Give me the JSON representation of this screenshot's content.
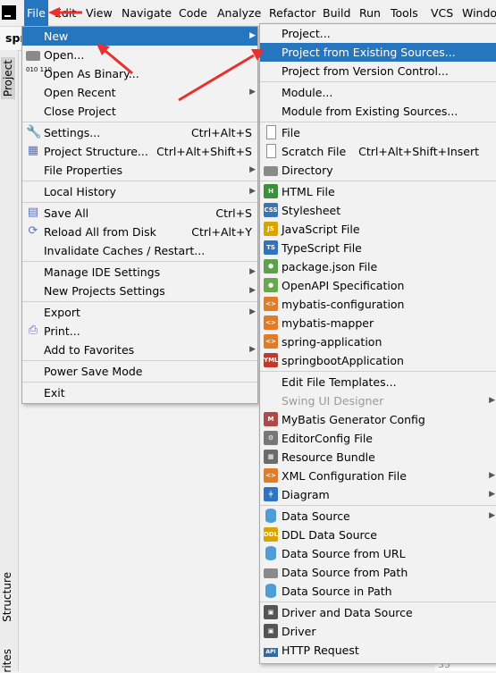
{
  "menubar": [
    "File",
    "Edit",
    "View",
    "Navigate",
    "Code",
    "Analyze",
    "Refactor",
    "Build",
    "Run",
    "Tools",
    "VCS",
    "Windo"
  ],
  "project_crumb": "spr",
  "side_tabs": {
    "project": "Project",
    "structure": "Structure",
    "favorites": "rites"
  },
  "gutter_number": "35",
  "file_menu": [
    {
      "label": "New",
      "arrow": true,
      "selected": true,
      "icon": ""
    },
    {
      "label": "Open...",
      "icon": "folder-icon"
    },
    {
      "label": "Open As Binary...",
      "icon": "binary-icon"
    },
    {
      "label": "Open Recent",
      "arrow": true
    },
    {
      "label": "Close Project"
    },
    {
      "sep": true
    },
    {
      "label": "Settings...",
      "shortcut": "Ctrl+Alt+S",
      "icon": "wrench-icon"
    },
    {
      "label": "Project Structure...",
      "shortcut": "Ctrl+Alt+Shift+S",
      "icon": "project-structure-icon"
    },
    {
      "label": "File Properties",
      "arrow": true
    },
    {
      "sep": true
    },
    {
      "label": "Local History",
      "arrow": true
    },
    {
      "sep": true
    },
    {
      "label": "Save All",
      "shortcut": "Ctrl+S",
      "icon": "save-icon"
    },
    {
      "label": "Reload All from Disk",
      "shortcut": "Ctrl+Alt+Y",
      "icon": "reload-icon"
    },
    {
      "label": "Invalidate Caches / Restart..."
    },
    {
      "sep": true
    },
    {
      "label": "Manage IDE Settings",
      "arrow": true
    },
    {
      "label": "New Projects Settings",
      "arrow": true
    },
    {
      "sep": true
    },
    {
      "label": "Export",
      "arrow": true
    },
    {
      "label": "Print...",
      "icon": "print-icon"
    },
    {
      "label": "Add to Favorites",
      "arrow": true
    },
    {
      "sep": true
    },
    {
      "label": "Power Save Mode"
    },
    {
      "sep": true
    },
    {
      "label": "Exit"
    }
  ],
  "new_menu": [
    {
      "label": "Project..."
    },
    {
      "label": "Project from Existing Sources...",
      "selected": true
    },
    {
      "label": "Project from Version Control..."
    },
    {
      "sep": true
    },
    {
      "label": "Module..."
    },
    {
      "label": "Module from Existing Sources..."
    },
    {
      "sep": true
    },
    {
      "label": "File",
      "icon": "file-icon"
    },
    {
      "label": "Scratch File",
      "shortcut": "Ctrl+Alt+Shift+Insert",
      "icon": "scratch-file-icon"
    },
    {
      "label": "Directory",
      "icon": "folder-icon"
    },
    {
      "sep": true
    },
    {
      "label": "HTML File",
      "icon": "html-file-icon",
      "tag": "H",
      "color": "#3c8f3c"
    },
    {
      "label": "Stylesheet",
      "icon": "css-file-icon",
      "tag": "CSS",
      "color": "#3b73b9"
    },
    {
      "label": "JavaScript File",
      "icon": "js-file-icon",
      "tag": "JS",
      "color": "#d9a400"
    },
    {
      "label": "TypeScript File",
      "icon": "ts-file-icon",
      "tag": "TS",
      "color": "#2f74c0"
    },
    {
      "label": "package.json File",
      "icon": "nodejs-icon",
      "tag": "⬢",
      "color": "#5fa04e"
    },
    {
      "label": "OpenAPI Specification",
      "icon": "openapi-icon",
      "tag": "●",
      "color": "#6aa84f"
    },
    {
      "label": "mybatis-configuration",
      "icon": "xml-file-icon",
      "tag": "<>",
      "color": "#e07b2a"
    },
    {
      "label": "mybatis-mapper",
      "icon": "xml-file-icon",
      "tag": "<>",
      "color": "#e07b2a"
    },
    {
      "label": "spring-application",
      "icon": "xml-file-icon",
      "tag": "<>",
      "color": "#e07b2a"
    },
    {
      "label": "springbootApplication",
      "icon": "yaml-file-icon",
      "tag": "YML",
      "color": "#c0392b"
    },
    {
      "sep": true
    },
    {
      "label": "Edit File Templates..."
    },
    {
      "label": "Swing UI Designer",
      "arrow": true,
      "disabled": true
    },
    {
      "label": "MyBatis Generator Config",
      "icon": "mybatis-icon",
      "tag": "M",
      "color": "#b04a4a"
    },
    {
      "label": "EditorConfig File",
      "icon": "gear-icon",
      "tag": "⚙",
      "color": "#777777"
    },
    {
      "label": "Resource Bundle",
      "icon": "resource-bundle-icon",
      "tag": "▦",
      "color": "#6b6b6b"
    },
    {
      "label": "XML Configuration File",
      "arrow": true,
      "icon": "xml-file-icon",
      "tag": "<>",
      "color": "#e07b2a"
    },
    {
      "label": "Diagram",
      "arrow": true,
      "icon": "diagram-icon",
      "tag": "╪",
      "color": "#2f74c0"
    },
    {
      "sep": true
    },
    {
      "label": "Data Source",
      "arrow": true,
      "icon": "database-icon"
    },
    {
      "label": "DDL Data Source",
      "icon": "ddl-icon",
      "tag": "DDL",
      "color": "#d9a400"
    },
    {
      "label": "Data Source from URL",
      "icon": "database-icon"
    },
    {
      "label": "Data Source from Path",
      "icon": "folder-icon"
    },
    {
      "label": "Data Source in Path",
      "icon": "database-icon"
    },
    {
      "sep": true
    },
    {
      "label": "Driver and Data Source",
      "icon": "driver-icon",
      "tag": "▣",
      "color": "#555555"
    },
    {
      "label": "Driver",
      "icon": "driver-icon",
      "tag": "▣",
      "color": "#555555"
    },
    {
      "label": "HTTP Request",
      "icon": "api-icon"
    }
  ]
}
